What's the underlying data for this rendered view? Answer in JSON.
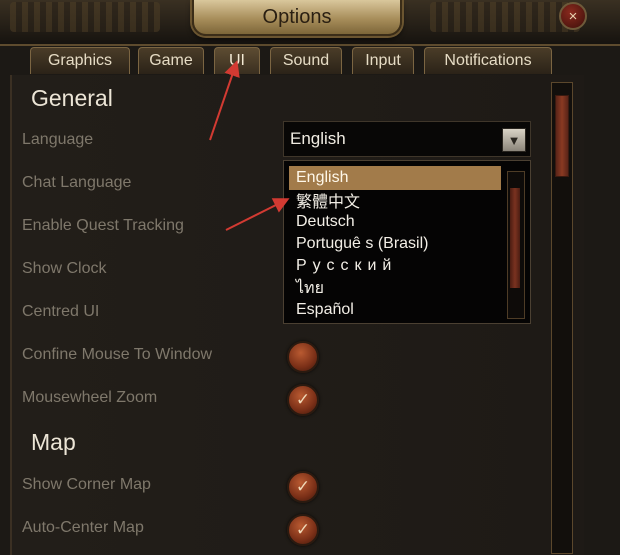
{
  "window": {
    "title": "Options",
    "close_symbol": "×"
  },
  "tabs": [
    {
      "label": "Graphics"
    },
    {
      "label": "Game"
    },
    {
      "label": "UI"
    },
    {
      "label": "Sound"
    },
    {
      "label": "Input"
    },
    {
      "label": "Notifications"
    }
  ],
  "general": {
    "title": "General",
    "language_label": "Language",
    "language_value": "English",
    "chat_language_label": "Chat Language",
    "quest_tracking_label": "Enable Quest Tracking",
    "show_clock_label": "Show Clock",
    "centred_ui_label": "Centred UI",
    "confine_mouse_label": "Confine Mouse To Window",
    "mousewheel_zoom_label": "Mousewheel Zoom",
    "checked_symbol": "✓"
  },
  "language_options": [
    "English",
    "繁體中文",
    "Deutsch",
    "Portuguê s (Brasil)",
    "Русский",
    "ไทย",
    "Español"
  ],
  "map": {
    "title": "Map",
    "show_corner_map_label": "Show Corner Map",
    "auto_center_map_label": "Auto-Center Map"
  },
  "settings": {
    "confine_mouse": false,
    "mousewheel_zoom": true,
    "show_corner_map": true,
    "auto_center_map": true
  },
  "colors": {
    "accent": "#a27b4a",
    "annotation_arrow": "#d23a32"
  }
}
